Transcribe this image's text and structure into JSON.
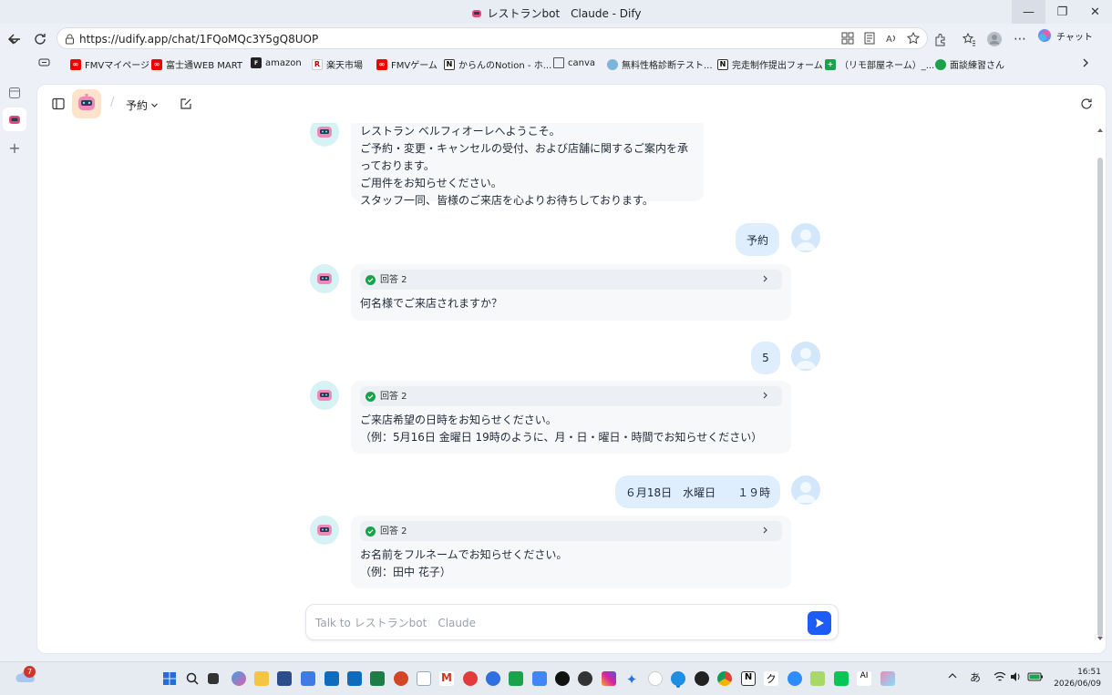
{
  "window": {
    "title": "レストランbot　Claude - Dify",
    "minimize": "—",
    "restore": "❐",
    "close": "✕"
  },
  "browser": {
    "url": "https://udify.app/chat/1FQoMQc3Y5gQ8UOP",
    "chat_label": "チャット"
  },
  "bookmarks": [
    {
      "label": "FMVマイページ"
    },
    {
      "label": "富士通WEB MART"
    },
    {
      "label": "amazon"
    },
    {
      "label": "楽天市場"
    },
    {
      "label": "FMVゲーム"
    },
    {
      "label": "からんのNotion - ホ..."
    },
    {
      "label": "canva"
    },
    {
      "label": "無料性格診断テスト..."
    },
    {
      "label": "完走制作提出フォーム"
    },
    {
      "label": "（リモ部屋ネーム）_..."
    },
    {
      "label": "面談練習さん"
    }
  ],
  "header": {
    "conversation_name": "予約"
  },
  "messages": {
    "m1": {
      "lines": [
        "レストラン ベルフィオーレへようこそ。",
        "ご予約・変更・キャンセルの受付、および店舗に関するご案内を承っております。",
        "ご用件をお知らせください。",
        "スタッフ一同、皆様のご来店を心よりお待ちしております。"
      ]
    },
    "u1": "予約",
    "m2": {
      "workflow": "回答 2",
      "lines": [
        "何名様でご来店されますか？"
      ]
    },
    "u2": "5",
    "m3": {
      "workflow": "回答 2",
      "lines": [
        "ご来店希望の日時をお知らせください。",
        "（例：5月16日 金曜日 19時のように、月・日・曜日・時間でお知らせください）"
      ]
    },
    "u3": "６月18日　水曜日　　１９時",
    "m4": {
      "workflow": "回答 2",
      "lines": [
        "お名前をフルネームでお知らせください。",
        "（例：田中 花子）"
      ]
    }
  },
  "input": {
    "placeholder": "Talk to レストランbot　Claude"
  },
  "taskbar": {
    "notification_count": "7",
    "ime": "あ",
    "time": "16:51",
    "date": "2026/06/09"
  },
  "colors": {
    "accent": "#1d5cf5",
    "user_bubble": "#dfeefd",
    "bot_bubble": "#f7f8fa",
    "success": "#16a34a"
  }
}
